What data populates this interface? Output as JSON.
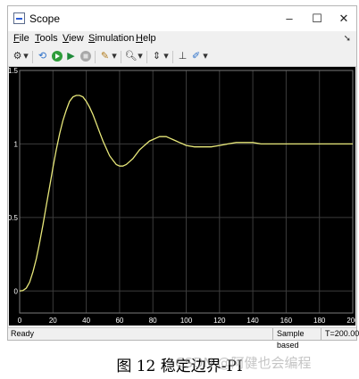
{
  "window": {
    "title": "Scope",
    "controls": [
      "–",
      "☐",
      "✕"
    ]
  },
  "menu": [
    {
      "label": "File",
      "accel": "F",
      "rest": "ile"
    },
    {
      "label": "Tools",
      "accel": "T",
      "rest": "ools"
    },
    {
      "label": "View",
      "accel": "V",
      "rest": "iew"
    },
    {
      "label": "Simulation",
      "accel": "S",
      "rest": "imulation"
    },
    {
      "label": "Help",
      "accel": "H",
      "rest": "elp"
    }
  ],
  "toolbar": {
    "icons": [
      "settings-icon",
      "dropdown-icon",
      "step-back-icon",
      "run-icon",
      "step-forward-icon",
      "stop-icon",
      "highlight-icon",
      "dropdown-icon",
      "zoom-icon",
      "dropdown-icon",
      "fit-icon",
      "dropdown-icon",
      "cursor-icon",
      "style-icon",
      "dropdown-icon"
    ]
  },
  "status": {
    "ready": "Ready",
    "mode": "Sample based",
    "time": "T=200.000"
  },
  "caption": "图 12  稳定边界-PI",
  "watermark": "CSDN @阿健也会编程",
  "chart_data": {
    "type": "line",
    "x_ticks": [
      "0",
      "20",
      "40",
      "60",
      "80",
      "100",
      "120",
      "140",
      "160",
      "180",
      "200"
    ],
    "y_ticks": [
      "0",
      "0.5",
      "1",
      "1.5"
    ],
    "xlim": [
      0,
      200
    ],
    "ylim": [
      -0.15,
      1.5
    ],
    "grid": true,
    "background": "#000000",
    "series": [
      {
        "color": "#e8e87a",
        "x": [
          0,
          2,
          4,
          6,
          8,
          10,
          12,
          14,
          16,
          18,
          20,
          22,
          24,
          26,
          28,
          30,
          32,
          34,
          36,
          38,
          40,
          42,
          44,
          46,
          48,
          50,
          52,
          54,
          56,
          58,
          60,
          62,
          64,
          66,
          68,
          70,
          72,
          74,
          76,
          78,
          80,
          82,
          84,
          86,
          88,
          90,
          92,
          94,
          96,
          98,
          100,
          105,
          110,
          115,
          120,
          125,
          130,
          135,
          140,
          145,
          150,
          155,
          160,
          165,
          170,
          175,
          180,
          185,
          190,
          195,
          200
        ],
        "y": [
          0,
          0.003,
          0.02,
          0.06,
          0.13,
          0.22,
          0.33,
          0.45,
          0.58,
          0.71,
          0.84,
          0.96,
          1.07,
          1.16,
          1.23,
          1.29,
          1.32,
          1.33,
          1.33,
          1.32,
          1.29,
          1.25,
          1.2,
          1.14,
          1.08,
          1.02,
          0.97,
          0.92,
          0.89,
          0.86,
          0.85,
          0.85,
          0.86,
          0.88,
          0.9,
          0.93,
          0.96,
          0.98,
          1.0,
          1.02,
          1.03,
          1.04,
          1.05,
          1.05,
          1.05,
          1.04,
          1.03,
          1.02,
          1.01,
          1.0,
          0.99,
          0.98,
          0.98,
          0.98,
          0.99,
          1.0,
          1.01,
          1.01,
          1.01,
          1.0,
          1.0,
          1.0,
          1.0,
          1.0,
          1.0,
          1.0,
          1.0,
          1.0,
          1.0,
          1.0,
          1.0
        ]
      }
    ]
  }
}
